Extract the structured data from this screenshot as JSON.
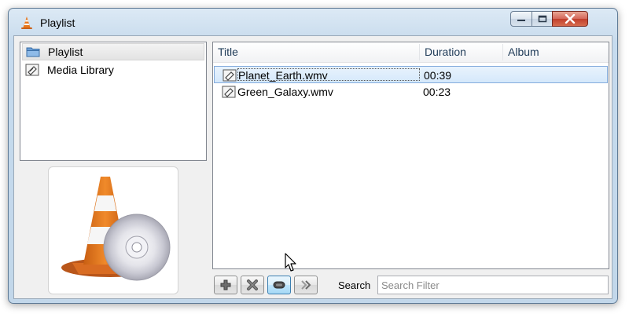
{
  "window": {
    "title": "Playlist",
    "icon": "vlc-cone-icon",
    "controls": [
      "minimize",
      "maximize",
      "close"
    ]
  },
  "sidebar": {
    "items": [
      {
        "label": "Playlist",
        "icon": "playlist-folder-icon",
        "selected": true
      },
      {
        "label": "Media Library",
        "icon": "media-library-icon",
        "selected": false
      }
    ]
  },
  "playlist": {
    "columns": [
      "Title",
      "Duration",
      "Album"
    ],
    "rows": [
      {
        "title": "Planet_Earth.wmv",
        "duration": "00:39",
        "album": "",
        "selected": true
      },
      {
        "title": "Green_Galaxy.wmv",
        "duration": "00:23",
        "album": "",
        "selected": false
      }
    ]
  },
  "toolbar": {
    "buttons": [
      {
        "icon": "add-icon"
      },
      {
        "icon": "remove-icon"
      },
      {
        "icon": "eject-icon",
        "active": true
      },
      {
        "icon": "forward-icon"
      }
    ]
  },
  "search": {
    "label": "Search",
    "placeholder": "Search Filter",
    "value": ""
  },
  "colors": {
    "titlebar": "#c9dced",
    "selection": "#d5e8fb",
    "close_button": "#c13f2c",
    "vlc_orange": "#e8781e"
  }
}
